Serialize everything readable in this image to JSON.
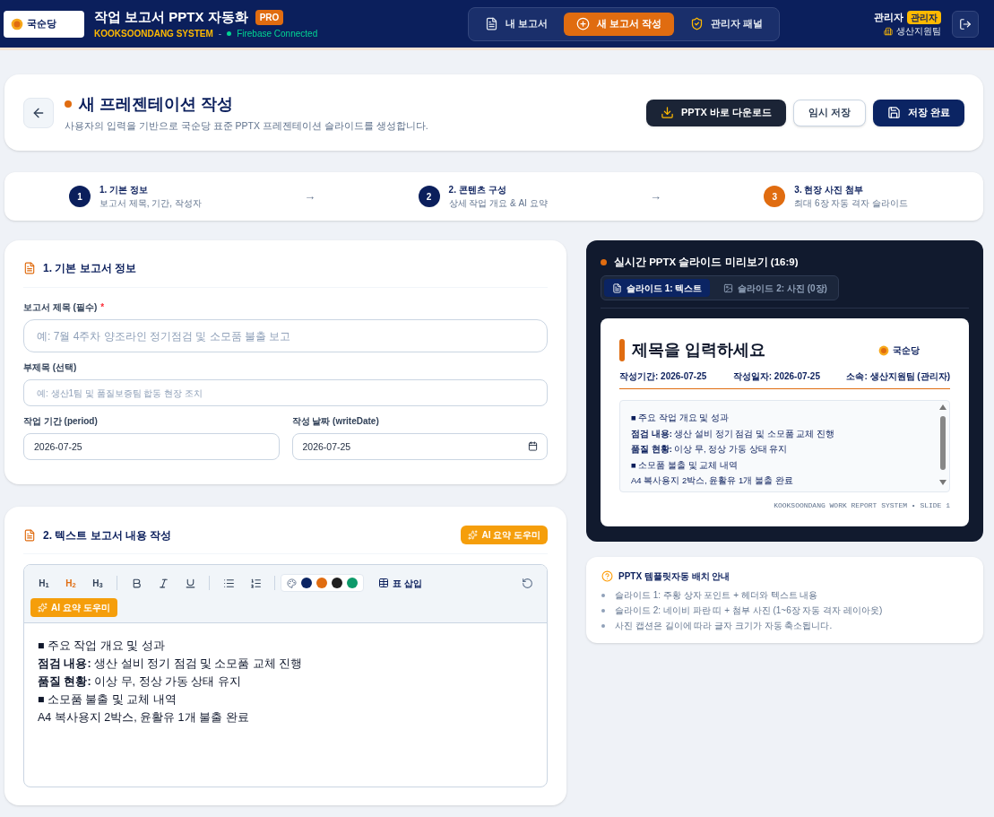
{
  "header": {
    "logo": "국순당",
    "title": "작업 보고서 PPTX 자동화",
    "badge": "PRO",
    "system": "KOOKSOONDANG SYSTEM",
    "separator": "-",
    "status": "Firebase Connected",
    "nav": [
      {
        "label": "내 보고서",
        "kind": "reports",
        "selected": false
      },
      {
        "label": "새 보고서 작성",
        "kind": "new",
        "selected": true
      },
      {
        "label": "관리자 패널",
        "kind": "admin",
        "selected": false
      }
    ],
    "user": {
      "name": "관리자",
      "role": "관리자",
      "team": "생산지원팀"
    }
  },
  "page_header": {
    "title": "새 프레젠테이션 작성",
    "description": "사용자의 입력을 기반으로 국순당 표준 PPTX 프레젠테이션 슬라이드를 생성합니다.",
    "buttons": [
      {
        "label": "PPTX 바로 다운로드",
        "kind": "download"
      },
      {
        "label": "임시 저장",
        "kind": "draft"
      },
      {
        "label": "저장 완료",
        "kind": "save"
      }
    ]
  },
  "steps": {
    "separator": "→",
    "items": [
      {
        "number": "1",
        "title": "1. 기본 정보",
        "subtitle": "보고서 제목, 기간, 작성자",
        "selected": false
      },
      {
        "number": "2",
        "title": "2. 콘텐츠 구성",
        "subtitle": "상세 작업 개요 & AI 요약",
        "selected": false
      },
      {
        "number": "3",
        "title": "3. 현장 사진 첨부",
        "subtitle": "최대 6장 자동 격자 슬라이드",
        "selected": true
      }
    ]
  },
  "basic_info": {
    "title": "1. 기본 보고서 정보",
    "fields": [
      {
        "label": "보고서 제목 (필수)",
        "required_mark": "*",
        "placeholder": "예: 7월 4주차 양조라인 정기점검 및 소모품 불출 보고",
        "kind": "large"
      },
      {
        "label": "부제목 (선택)",
        "placeholder": "예: 생산1팀 및 품질보증팀 합동 현장 조치",
        "kind": "text"
      },
      {
        "label": "작업 기간 (period)",
        "value": "2026-07-25",
        "kind": "text"
      },
      {
        "label": "작성 날짜 (writeDate)",
        "value": "2026-07-25",
        "kind": "date"
      }
    ]
  },
  "content": {
    "title": "2. 텍스트 보고서 내용 작성",
    "ai_button": "AI 요약 도우미",
    "headings": [
      {
        "label": "H$_{1}$",
        "selected": false
      },
      {
        "label": "H$_{2}$",
        "selected": true
      },
      {
        "label": "H$_{3}$",
        "selected": false
      }
    ],
    "colors": [
      {
        "color": "#0b2463"
      },
      {
        "color": "#e06c10"
      },
      {
        "color": "#1f1f1f"
      },
      {
        "color": "#0d9a6a"
      }
    ],
    "table_button": "표 삽입",
    "toolbar_ai_button": "AI 요약 도우미",
    "lines": [
      "■ 주요 작업 개요 및 성과",
      "**점검 내용:** 생산 설비 정기 점검 및 소모품 교체 진행",
      "**품질 현황:** 이상 무, 정상 가동 상태 유지",
      "■ 소모품 불출 및 교체 내역",
      "A4 복사용지 2박스, 윤활유 1개 불출 완료"
    ]
  },
  "preview": {
    "title": "실시간 PPTX 슬라이드 미리보기 (16:9)",
    "tabs": [
      {
        "label": "슬라이드 1: 텍스트",
        "kind": "text",
        "selected": true
      },
      {
        "label": "슬라이드 2: 사진 (0장)",
        "kind": "photo",
        "selected": false
      }
    ],
    "slide": {
      "title": "제목을 입력하세요",
      "logo": "국순당",
      "meta": [
        "작성기간: 2026-07-25",
        "작성일자: 2026-07-25",
        "소속: 생산지원팀 (관리자)"
      ],
      "lines": [
        "■ 주요 작업 개요 및 성과",
        "**점검 내용:** 생산 설비 정기 점검 및 소모품 교체 진행",
        "**품질 현황:** 이상 무, 정상 가동 상태 유지",
        "■ 소모품 불출 및 교체 내역",
        "A4 복사용지 2박스, 윤활유 1개 불출 완료"
      ],
      "footer": "KOOKSOONDANG WORK REPORT SYSTEM • SLIDE 1"
    }
  },
  "guide": {
    "title": "PPTX 템플릿자동 배치 안내",
    "items": [
      "슬라이드 1: 주황 상자 포인트 + 헤더와 텍스트 내용",
      "슬라이드 2: 네이비 파란 띠 + 첨부 사진 (1~6장 자동 격자 레이아웃)",
      "사진 캡션은 길이에 따라 글자 크기가 자동 축소됩니다."
    ]
  }
}
